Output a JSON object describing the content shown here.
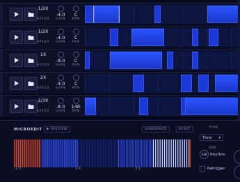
{
  "tracks": [
    {
      "speed": "1/2X",
      "gain": "-4.0",
      "pan": "C",
      "labels": {
        "speed": "SPEED",
        "gain": "GAIN",
        "pan": "PAN"
      },
      "segments": [
        [
          0.0,
          0.05,
          "n"
        ],
        [
          0.055,
          0.215,
          "sel"
        ],
        [
          0.45,
          0.49,
          "n"
        ],
        [
          0.79,
          1.0,
          "hi"
        ]
      ]
    },
    {
      "speed": "1/2X",
      "gain": "-4.0",
      "pan": "C",
      "labels": {
        "speed": "SPEED",
        "gain": "GAIN",
        "pan": "PAN"
      },
      "segments": [
        [
          0.16,
          0.215,
          "n"
        ],
        [
          0.3,
          0.51,
          "hi"
        ],
        [
          0.69,
          0.73,
          "n"
        ],
        [
          0.8,
          0.86,
          "n"
        ]
      ]
    },
    {
      "speed": "1X",
      "gain": "-8.0",
      "pan": "C",
      "labels": {
        "speed": "SPEED",
        "gain": "GAIN",
        "pan": "PAN"
      },
      "segments": [
        [
          0.0,
          0.03,
          "n"
        ],
        [
          0.16,
          0.5,
          "hi"
        ],
        [
          0.53,
          0.57,
          "n"
        ],
        [
          0.69,
          0.73,
          "n"
        ]
      ]
    },
    {
      "speed": "2X",
      "gain": "-4.0",
      "pan": "C",
      "labels": {
        "speed": "SPEED",
        "gain": "GAIN",
        "pan": "PAN"
      },
      "segments": [
        [
          0.31,
          0.38,
          "n"
        ],
        [
          0.62,
          0.69,
          "n"
        ],
        [
          0.73,
          0.8,
          "n"
        ],
        [
          0.84,
          1.0,
          "hi"
        ]
      ]
    },
    {
      "speed": "2/3X",
      "gain": "-8.0",
      "pan": "14R",
      "labels": {
        "speed": "SPEED",
        "gain": "GAIN",
        "pan": "PAN"
      },
      "segments": [
        [
          0.0,
          0.07,
          "hi"
        ],
        [
          0.35,
          0.41,
          "n"
        ],
        [
          0.62,
          0.68,
          "n"
        ],
        [
          0.645,
          1.0,
          "hi"
        ]
      ]
    }
  ],
  "microedit": {
    "title": "MICROEDIT",
    "preview_label": "PREVIEW",
    "randomize_label": "RANDOMIZE",
    "reset_label": "RESET",
    "markers": [
      "1:3",
      "1:4",
      "2:1"
    ],
    "type_title": "TYPE",
    "type_value": "Time",
    "unit_label": "Unit",
    "rhythm_value": "1/8",
    "rhythm_label": "Rhythm",
    "retrigger_label": "Retrigger"
  },
  "colors": {
    "accent": "#1b39d8",
    "highlight": "#2b54ff",
    "warm": "#c2401f",
    "background": "#070a1d"
  },
  "icons": {
    "play": "play-icon",
    "folder": "folder-icon"
  }
}
